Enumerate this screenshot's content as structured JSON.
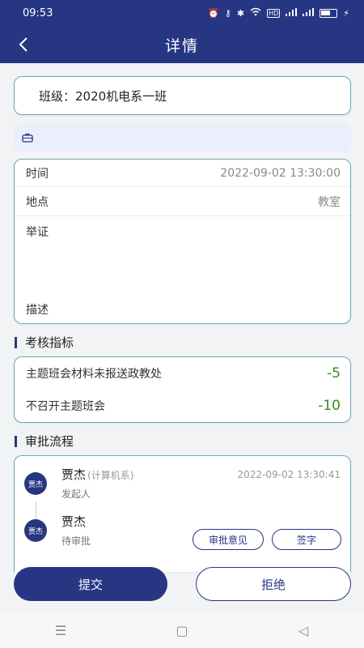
{
  "status_bar": {
    "time": "09:53",
    "network_badge": "HD"
  },
  "nav": {
    "title": "详情"
  },
  "class_info": {
    "label": "班级：2020机电系一班"
  },
  "details": {
    "time_label": "时间",
    "time_value": "2022-09-02 13:30:00",
    "place_label": "地点",
    "place_value": "教室",
    "evidence_label": "举证",
    "description_label": "描述"
  },
  "assessment": {
    "title": "考核指标",
    "items": [
      {
        "name": "主题班会材料未报送政教处",
        "score": "-5"
      },
      {
        "name": "不召开主题班会",
        "score": "-10"
      }
    ]
  },
  "approval": {
    "title": "审批流程",
    "steps": [
      {
        "avatar_text": "贾杰",
        "name": "贾杰",
        "dept": "(计算机系)",
        "role": "发起人",
        "time": "2022-09-02 13:30:41"
      },
      {
        "avatar_text": "贾杰",
        "name": "贾杰",
        "role": "待审批",
        "opinion_label": "审批意见",
        "sign_label": "签字"
      }
    ]
  },
  "actions": {
    "submit_label": "提交",
    "reject_label": "拒绝"
  },
  "system_nav": {
    "menu_glyph": "☰",
    "home_glyph": "▢",
    "back_glyph": "◁"
  },
  "colors": {
    "primary": "#273683",
    "card_border": "#6aa8b8",
    "score_green": "#3b8a1f",
    "info_strip": "#ebeefb"
  },
  "icons": {
    "back": "chevron-left-icon",
    "attachment": "briefcase-icon",
    "avatar": "user-avatar-icon"
  }
}
